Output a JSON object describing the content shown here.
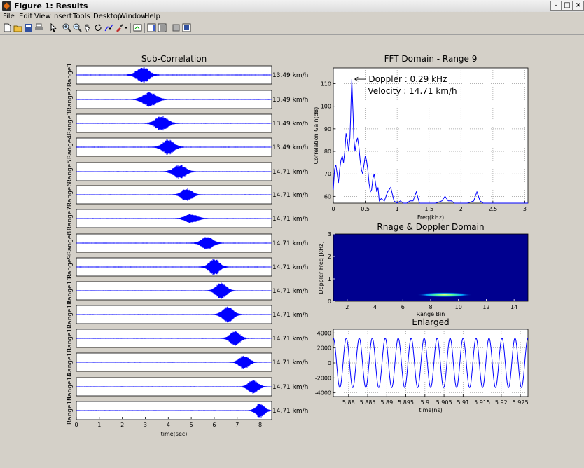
{
  "window": {
    "title": "Figure 1: Results"
  },
  "menu": [
    "File",
    "Edit",
    "View",
    "Insert",
    "Tools",
    "Desktop",
    "Window",
    "Help"
  ],
  "toolbar_icons": [
    "new-file-icon",
    "open-folder-icon",
    "save-icon",
    "print-icon",
    "pointer-icon",
    "zoom-in-icon",
    "zoom-out-icon",
    "pan-icon",
    "rotate-icon",
    "data-cursor-icon",
    "brush-icon",
    "link-icon",
    "colorbar-icon",
    "legend-icon",
    "hide-tools-icon",
    "show-tools-icon"
  ],
  "colors": {
    "signal": "#0000ff",
    "figure_bg": "#d4d0c8",
    "axes_bg": "#ffffff"
  },
  "chart_data": [
    {
      "type": "line",
      "title": "Sub-Correlation",
      "xlabel": "time(sec)",
      "xlim": [
        0,
        8.5
      ],
      "xticks": [
        0,
        1,
        2,
        3,
        4,
        5,
        6,
        7,
        8
      ],
      "series": [
        {
          "name": "Range1",
          "center": 2.9,
          "width": 0.35,
          "amp": 0.95,
          "speed": "13.49 km/h"
        },
        {
          "name": "Range2",
          "center": 3.2,
          "width": 0.38,
          "amp": 0.85,
          "speed": "13.49 km/h"
        },
        {
          "name": "Range3",
          "center": 3.7,
          "width": 0.35,
          "amp": 0.85,
          "speed": "13.49 km/h"
        },
        {
          "name": "Range4",
          "center": 4.0,
          "width": 0.32,
          "amp": 0.9,
          "speed": "13.49 km/h"
        },
        {
          "name": "Range5",
          "center": 4.5,
          "width": 0.35,
          "amp": 0.8,
          "speed": "14.71 km/h"
        },
        {
          "name": "Range6",
          "center": 4.8,
          "width": 0.3,
          "amp": 0.75,
          "speed": "14.71 km/h"
        },
        {
          "name": "Range7",
          "center": 5.0,
          "width": 0.35,
          "amp": 0.5,
          "speed": "14.71 km/h"
        },
        {
          "name": "Range8",
          "center": 5.7,
          "width": 0.32,
          "amp": 0.75,
          "speed": "14.71 km/h"
        },
        {
          "name": "Range9",
          "center": 6.0,
          "width": 0.3,
          "amp": 0.95,
          "speed": "14.71 km/h"
        },
        {
          "name": "Range10",
          "center": 6.3,
          "width": 0.3,
          "amp": 0.95,
          "speed": "14.71 km/h"
        },
        {
          "name": "Range11",
          "center": 6.6,
          "width": 0.3,
          "amp": 0.95,
          "speed": "14.71 km/h"
        },
        {
          "name": "Range12",
          "center": 6.9,
          "width": 0.28,
          "amp": 0.85,
          "speed": "14.71 km/h"
        },
        {
          "name": "Range13",
          "center": 7.3,
          "width": 0.28,
          "amp": 0.8,
          "speed": "14.71 km/h"
        },
        {
          "name": "Range14",
          "center": 7.7,
          "width": 0.28,
          "amp": 0.8,
          "speed": "14.71 km/h"
        },
        {
          "name": "Range15",
          "center": 8.0,
          "width": 0.25,
          "amp": 0.85,
          "speed": "14.71 km/h"
        }
      ]
    },
    {
      "type": "line",
      "title": "FFT Domain - Range 9",
      "xlabel": "Freq(kHz)",
      "ylabel": "Correlation Gain(dB)",
      "xlim": [
        0,
        3.05
      ],
      "ylim": [
        57,
        117
      ],
      "xticks": [
        0,
        0.5,
        1,
        1.5,
        2,
        2.5,
        3
      ],
      "yticks": [
        60,
        70,
        80,
        90,
        100,
        110
      ],
      "grid": true,
      "annotation": {
        "line1": "Doppler : 0.29 kHz",
        "line2": "Velocity : 14.71 km/h",
        "x": 0.29,
        "y": 112
      },
      "series": [
        {
          "x": [
            0,
            0.02,
            0.04,
            0.06,
            0.08,
            0.1,
            0.12,
            0.14,
            0.16,
            0.18,
            0.2,
            0.22,
            0.24,
            0.26,
            0.27,
            0.28,
            0.29,
            0.3,
            0.31,
            0.32,
            0.34,
            0.36,
            0.38,
            0.4,
            0.42,
            0.44,
            0.46,
            0.48,
            0.5,
            0.52,
            0.54,
            0.56,
            0.58,
            0.6,
            0.62,
            0.64,
            0.66,
            0.68,
            0.7,
            0.72,
            0.75,
            0.8,
            0.85,
            0.9,
            0.95,
            1.0,
            1.05,
            1.1,
            1.15,
            1.2,
            1.25,
            1.3,
            1.35,
            1.4,
            1.5,
            1.6,
            1.7,
            1.75,
            1.8,
            1.85,
            1.9,
            2.0,
            2.1,
            2.2,
            2.25,
            2.3,
            2.35,
            2.4,
            2.5,
            2.6,
            2.7,
            2.8,
            2.9,
            3.0,
            3.05
          ],
          "y": [
            63,
            72,
            74,
            70,
            66,
            72,
            76,
            78,
            75,
            80,
            88,
            85,
            80,
            86,
            94,
            104,
            112,
            104,
            96,
            86,
            80,
            84,
            86,
            82,
            76,
            72,
            70,
            74,
            78,
            76,
            72,
            66,
            62,
            63,
            68,
            70,
            66,
            62,
            64,
            58,
            59,
            58,
            62,
            64,
            58,
            57,
            58,
            56,
            56,
            58,
            58,
            62,
            56,
            55,
            57,
            56,
            58,
            60,
            58,
            58,
            56,
            57,
            57,
            58,
            62,
            58,
            56,
            57,
            57,
            56,
            57,
            57,
            57,
            57,
            57
          ]
        }
      ]
    },
    {
      "type": "heatmap",
      "title": "Rnage & Doppler Domain",
      "xlabel": "Range Bin",
      "ylabel": "Doppler Freq [kHz]",
      "xlim": [
        1,
        15
      ],
      "ylim": [
        0,
        3
      ],
      "xticks": [
        2,
        4,
        6,
        8,
        10,
        12,
        14
      ],
      "yticks": [
        0,
        1,
        2,
        3
      ],
      "background_color": "#00008f",
      "peak": {
        "range_bin": 9,
        "doppler_khz": 0.29
      }
    },
    {
      "type": "line",
      "title": "Enlarged",
      "xlabel": "time(ns)",
      "xlim": [
        5.876,
        5.927
      ],
      "ylim": [
        -4500,
        4500
      ],
      "xticks": [
        5.88,
        5.885,
        5.89,
        5.895,
        5.9,
        5.905,
        5.91,
        5.915,
        5.92,
        5.925
      ],
      "xtick_labels": [
        "5.88",
        "5.885",
        "5.89",
        "5.895",
        "5.9",
        "5.905",
        "5.91",
        "5.915",
        "5.92",
        "5.925"
      ],
      "yticks": [
        -4000,
        -2000,
        0,
        2000,
        4000
      ],
      "grid": true,
      "series": [
        {
          "amplitude": 3300,
          "cycles": 15,
          "phase": 1.57
        }
      ]
    }
  ]
}
